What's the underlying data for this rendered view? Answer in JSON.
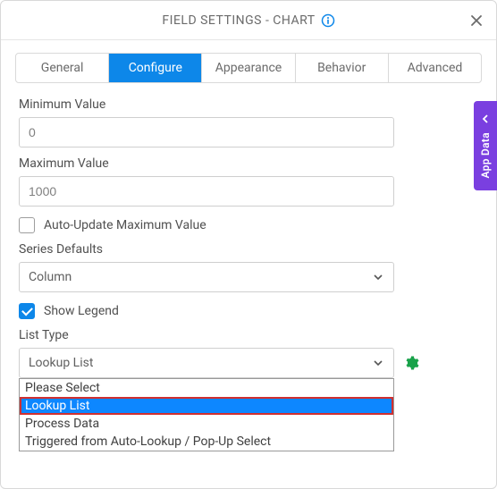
{
  "header": {
    "title": "FIELD SETTINGS - CHART"
  },
  "tabs": {
    "items": [
      {
        "label": "General"
      },
      {
        "label": "Configure"
      },
      {
        "label": "Appearance"
      },
      {
        "label": "Behavior"
      },
      {
        "label": "Advanced"
      }
    ],
    "active_index": 1
  },
  "form": {
    "min_label": "Minimum Value",
    "min_value": "0",
    "max_label": "Maximum Value",
    "max_value": "1000",
    "auto_update_label": "Auto-Update Maximum Value",
    "auto_update_checked": false,
    "series_defaults_label": "Series Defaults",
    "series_defaults_value": "Column",
    "show_legend_label": "Show Legend",
    "show_legend_checked": true,
    "list_type_label": "List Type",
    "list_type_value": "Lookup List",
    "list_type_options": [
      "Please Select",
      "Lookup List",
      "Process Data",
      "Triggered from Auto-Lookup / Pop-Up Select"
    ],
    "list_type_highlight_index": 1
  },
  "side_panel": {
    "label": "App Data"
  },
  "colors": {
    "primary": "#0d87e9",
    "accent_purple": "#7a3fe0",
    "gear_green": "#19a24a",
    "highlight_red": "#d03030"
  }
}
